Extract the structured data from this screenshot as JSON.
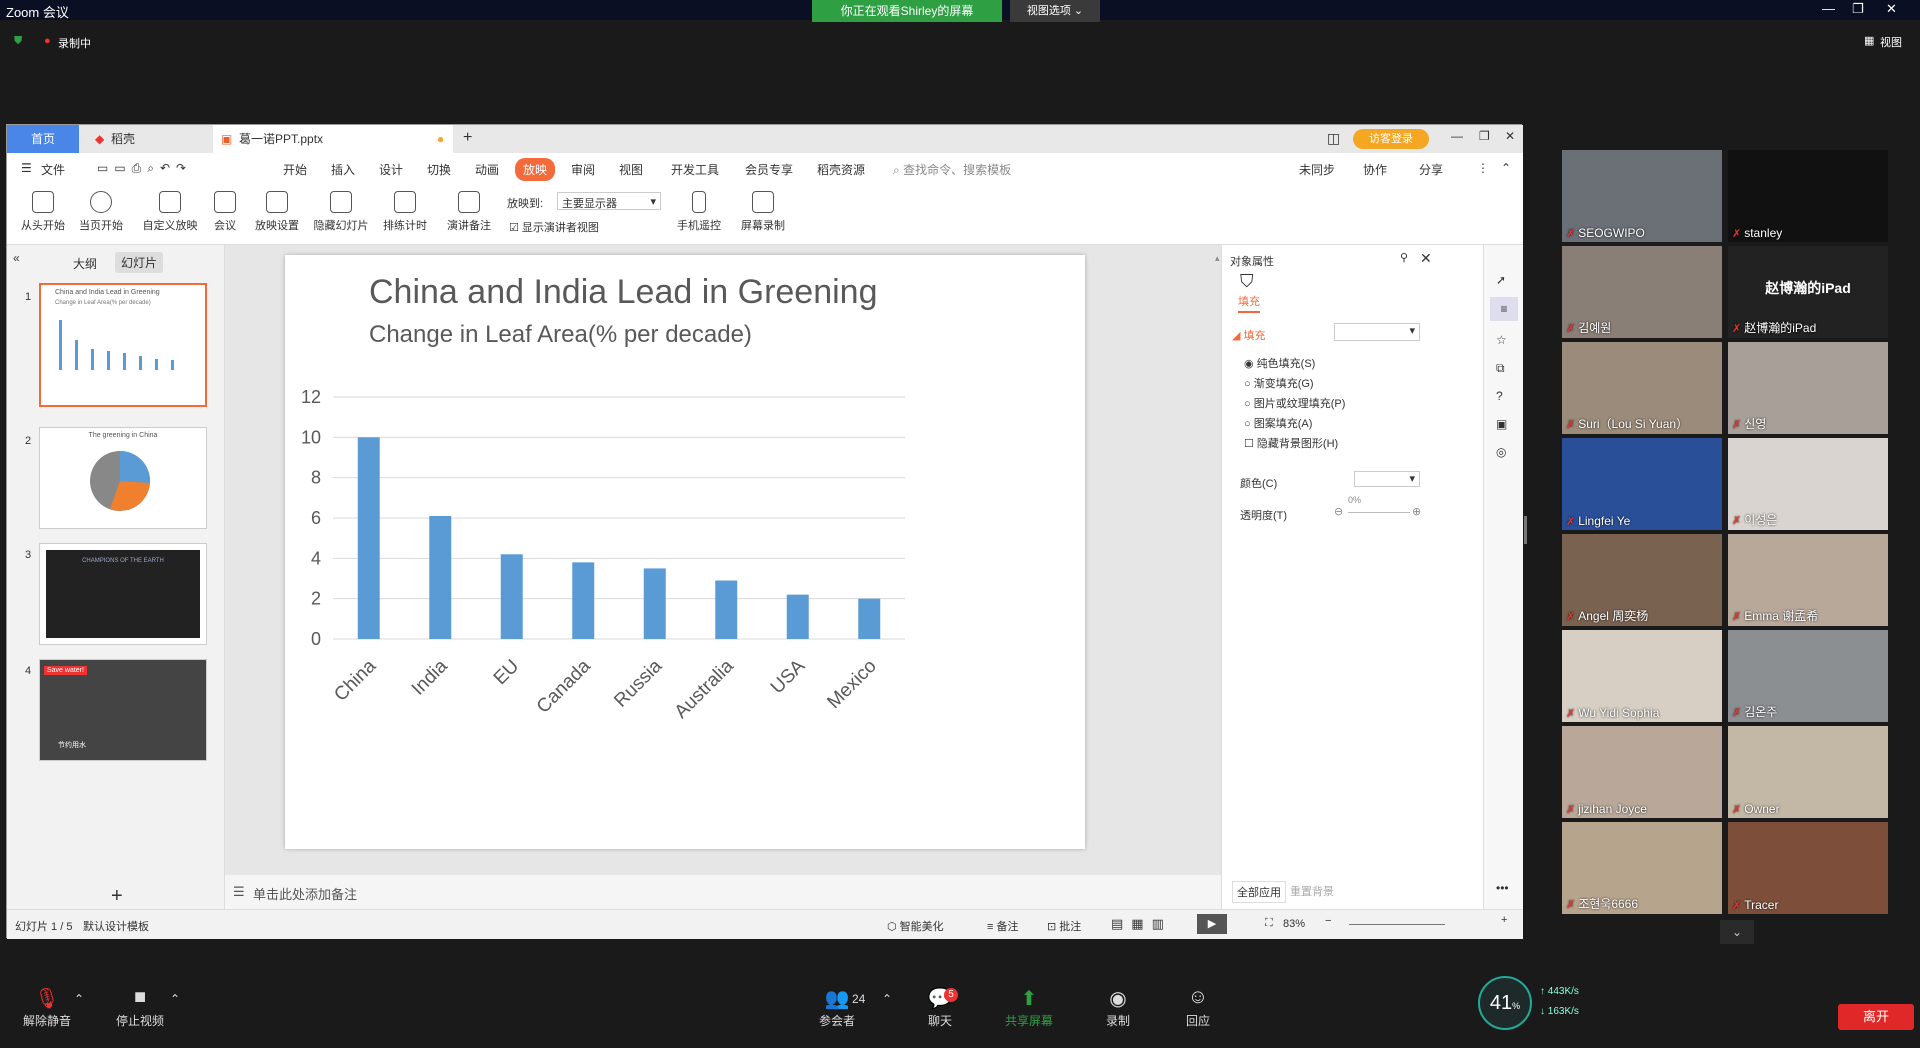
{
  "zoom": {
    "title": "Zoom 会议",
    "share_banner": "你正在观看Shirley的屏幕",
    "view_options": "视图选项",
    "recording": "录制中",
    "view_label": "视图"
  },
  "wps": {
    "tabs": [
      {
        "label": "首页"
      },
      {
        "label": "稻壳"
      },
      {
        "label": "葛一诺PPT.pptx"
      }
    ],
    "guest_login": "访客登录",
    "menu": [
      "文件",
      "开始",
      "插入",
      "设计",
      "切换",
      "动画",
      "放映",
      "审阅",
      "视图",
      "开发工具",
      "会员专享",
      "稻壳资源"
    ],
    "search_placeholder": "查找命令、搜索模板",
    "sync": "未同步",
    "collab": "协作",
    "share": "分享",
    "toolbar": [
      {
        "label": "从头开始"
      },
      {
        "label": "当页开始"
      },
      {
        "label": "自定义放映"
      },
      {
        "label": "会议"
      },
      {
        "label": "放映设置"
      },
      {
        "label": "隐藏幻灯片"
      },
      {
        "label": "排练计时"
      },
      {
        "label": "演讲备注"
      },
      {
        "label": "手机遥控"
      },
      {
        "label": "屏幕录制"
      }
    ],
    "project_to_label": "放映到:",
    "project_to_value": "主要显示器",
    "presenter_view": "显示演讲者视图",
    "pane_tabs": [
      "大纲",
      "幻灯片"
    ],
    "thumbs": [
      {
        "num": "1",
        "title": "China and India Lead in Greening",
        "sub": "Change in Leaf Area(% per decade)"
      },
      {
        "num": "2",
        "title": "The greening in China"
      },
      {
        "num": "3",
        "title": "CHAMPIONS OF THE EARTH"
      },
      {
        "num": "4",
        "title": "Save water!",
        "sub": "节约用水"
      }
    ],
    "notes_placeholder": "单击此处添加备注",
    "status": {
      "slide": "幻灯片 1 / 5",
      "template": "默认设计模板",
      "beautify": "智能美化",
      "notes": "备注",
      "comment": "批注",
      "zoom": "83%"
    },
    "props": {
      "title": "对象属性",
      "fill_tab": "填充",
      "fill_section": "填充",
      "options": [
        "纯色填充(S)",
        "渐变填充(G)",
        "图片或纹理填充(P)",
        "图案填充(A)"
      ],
      "hide_bg": "隐藏背景图形(H)",
      "color": "颜色(C)",
      "transparency": "透明度(T)",
      "transparency_value": "0%",
      "apply_all": "全部应用",
      "reset_bg": "重置背景"
    }
  },
  "chart_data": {
    "type": "bar",
    "title": "China and India Lead in Greening",
    "subtitle": "Change in Leaf Area(% per decade)",
    "categories": [
      "China",
      "India",
      "EU",
      "Canada",
      "Russia",
      "Australia",
      "USA",
      "Mexico"
    ],
    "values": [
      10,
      6.1,
      4.2,
      3.8,
      3.5,
      2.9,
      2.2,
      2.0
    ],
    "ylim": [
      0,
      12
    ],
    "yticks": [
      "0",
      "2",
      "4",
      "6",
      "8",
      "10",
      "12"
    ],
    "color": "#5b9bd5",
    "grid": true
  },
  "participants": [
    {
      "name": "SEOGWIPO"
    },
    {
      "name": "stanley"
    },
    {
      "name": "김예원"
    },
    {
      "name": "赵博瀚的iPad",
      "center": "赵博瀚的iPad"
    },
    {
      "name": "Suri（Lou Si Yuan）"
    },
    {
      "name": "신영"
    },
    {
      "name": "Lingfei Ye"
    },
    {
      "name": "이성은"
    },
    {
      "name": "Angel 周奕杨"
    },
    {
      "name": "Emma 谢孟希"
    },
    {
      "name": "Wu Yidi Sophia"
    },
    {
      "name": "김온주"
    },
    {
      "name": "jizihan Joyce"
    },
    {
      "name": "Owner"
    },
    {
      "name": "조현욱6666"
    },
    {
      "name": "Tracer"
    }
  ],
  "bottom": {
    "unmute": "解除静音",
    "stop_video": "停止视频",
    "participants": "参会者",
    "participant_count": "24",
    "chat": "聊天",
    "chat_badge": "5",
    "share": "共享屏幕",
    "record": "录制",
    "reactions": "回应",
    "leave": "离开",
    "cpu": "41",
    "cpu_unit": "%",
    "up": "443K/s",
    "down": "163K/s"
  }
}
